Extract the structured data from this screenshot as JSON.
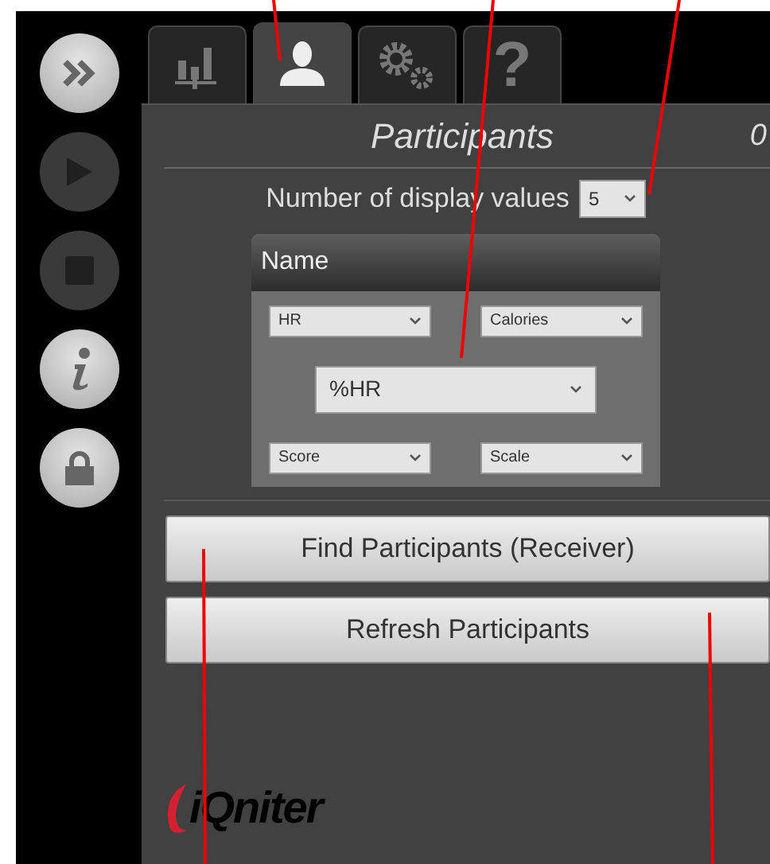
{
  "sidebar": {
    "buttons": [
      {
        "kind": "forward",
        "enabled": true
      },
      {
        "kind": "play",
        "enabled": false
      },
      {
        "kind": "stop",
        "enabled": false
      },
      {
        "kind": "info",
        "enabled": true
      },
      {
        "kind": "lock",
        "enabled": true
      }
    ]
  },
  "tabs": [
    {
      "kind": "chart",
      "selected": false
    },
    {
      "kind": "person",
      "selected": true
    },
    {
      "kind": "gears",
      "selected": false
    },
    {
      "kind": "glyph",
      "text": "?",
      "selected": false
    }
  ],
  "panel": {
    "title": "Participants",
    "count": "0",
    "display_values": {
      "label": "Number of display values",
      "value": "5"
    },
    "layout_card": {
      "header": "Name",
      "fields": [
        {
          "value": "HR",
          "kind": "small"
        },
        {
          "value": "Calories",
          "kind": "small"
        },
        {
          "value": "%HR",
          "kind": "large"
        },
        {
          "value": "Score",
          "kind": "small"
        },
        {
          "value": "Scale",
          "kind": "small"
        }
      ]
    },
    "buttons": [
      "Find Participants (Receiver)",
      "Refresh Participants"
    ],
    "logo": "iQniter"
  }
}
